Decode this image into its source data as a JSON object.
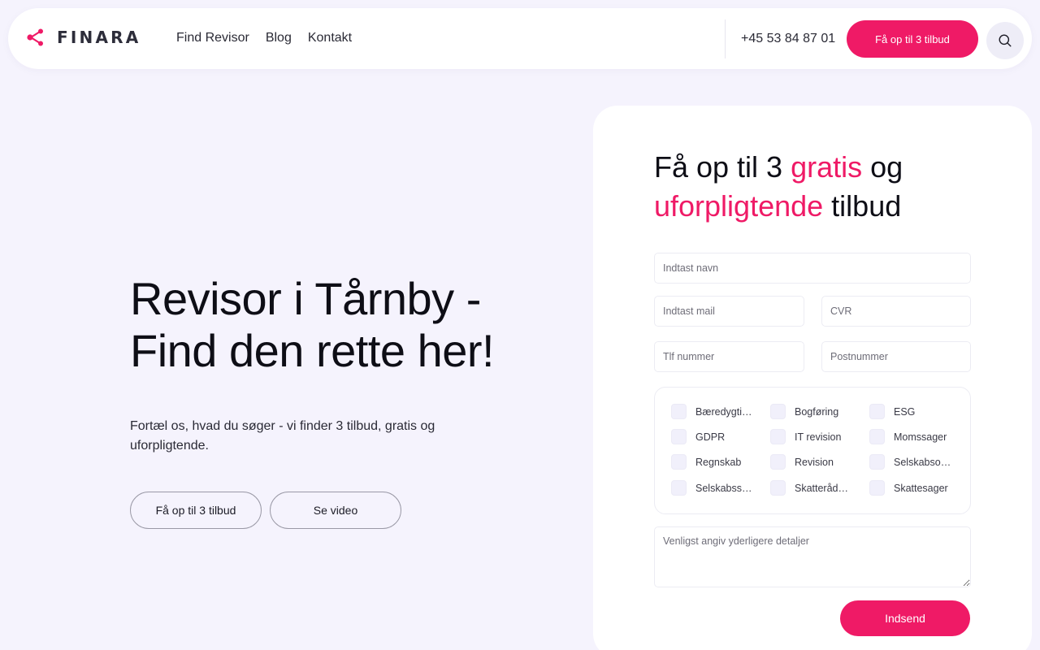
{
  "brand": {
    "name": "FINARA",
    "accent_color": "#ef1a66",
    "logo_icon": "share-nodes-icon"
  },
  "header": {
    "nav": [
      {
        "label": "Find Revisor"
      },
      {
        "label": "Blog"
      },
      {
        "label": "Kontakt"
      }
    ],
    "phone": "+45 53 84 87 01",
    "cta_label": "Få op til 3 tilbud",
    "search_icon": "search-icon"
  },
  "hero": {
    "title_line1": "Revisor i Tårnby -",
    "title_line2": "Find den rette her!",
    "subtitle": "Fortæl os, hvad du søger - vi finder 3 tilbud, gratis og uforpligtende.",
    "primary_button": "Få op til 3 tilbud",
    "video_button": "Se video"
  },
  "form": {
    "title_part1": "Få op til 3 ",
    "title_accent1": "gratis",
    "title_part2": " og",
    "title_accent2": "uforpligtende",
    "title_part3": " tilbud",
    "fields": {
      "name_placeholder": "Indtast navn",
      "mail_placeholder": "Indtast mail",
      "cvr_placeholder": "CVR",
      "phone_placeholder": "Tlf nummer",
      "postal_placeholder": "Postnummer"
    },
    "services": [
      {
        "label": "Bæredygtighed"
      },
      {
        "label": "Bogføring"
      },
      {
        "label": "ESG"
      },
      {
        "label": "GDPR"
      },
      {
        "label": "IT revision"
      },
      {
        "label": "Momssager"
      },
      {
        "label": "Regnskab"
      },
      {
        "label": "Revision"
      },
      {
        "label": "Selskabsoprettelse"
      },
      {
        "label": "Selskabsstiftelse"
      },
      {
        "label": "Skatterådgivning"
      },
      {
        "label": "Skattesager"
      }
    ],
    "details_placeholder": "Venligst angiv yderligere detaljer",
    "submit_label": "Indsend"
  }
}
